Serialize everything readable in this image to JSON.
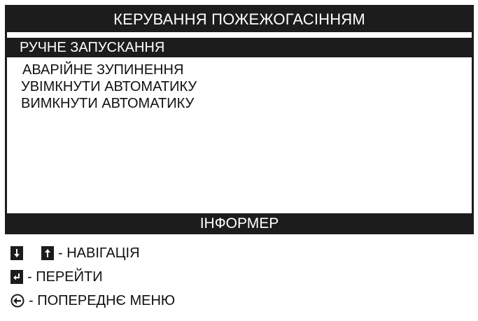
{
  "title": "КЕРУВАННЯ ПОЖЕЖОГАСІННЯМ",
  "menu": {
    "items": [
      {
        "label": "РУЧНЕ ЗАПУСКАННЯ",
        "selected": true
      },
      {
        "label": "АВАРІЙНЕ ЗУПИНЕННЯ",
        "selected": false
      },
      {
        "label": "УВІМКНУТИ АВТОМАТИКУ",
        "selected": false
      },
      {
        "label": "ВИМКНУТИ АВТОМАТИКУ",
        "selected": false
      }
    ]
  },
  "informer": {
    "title": "ІНФОРМЕР",
    "lines": [
      {
        "icons": [
          "arrow-down-icon",
          "arrow-up-icon"
        ],
        "text": "- НАВІГАЦІЯ"
      },
      {
        "icons": [
          "enter-icon"
        ],
        "text": "- ПЕРЕЙТИ"
      },
      {
        "icons": [
          "back-arrow-circle-icon"
        ],
        "text": "- ПОПЕРЕДНЄ МЕНЮ"
      }
    ]
  },
  "colors": {
    "bar": "#1c1c1c",
    "bar_text": "#ffffff",
    "background": "#ffffff",
    "text": "#111111"
  }
}
